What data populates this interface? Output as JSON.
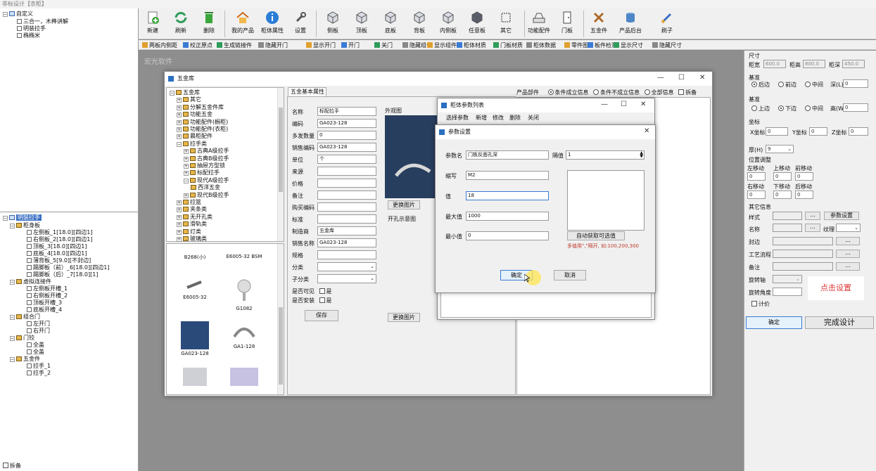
{
  "app": {
    "title": "非标设计【衣柜】",
    "brand": "宏光软件"
  },
  "left_top_tree": {
    "root": "自定义",
    "items": [
      "三合一，木榫讲解",
      "明装拉手",
      "椭椭米"
    ]
  },
  "left_bottom_tree": {
    "root": "明装拉手",
    "groups": [
      {
        "label": "柜身板",
        "items": [
          "左侧板_1[18.0][四边1]",
          "右侧板_2[18.0][四边1]",
          "顶板_3[18.0][四边1]",
          "底板_4[18.0][四边1]",
          "薄背板_5[9.0][不封边]",
          "踢脚板（前）_6[18.0][四边1]",
          "踢脚板（后）_7[18.0][1]"
        ]
      },
      {
        "label": "虚拟连接件",
        "items": [
          "左侧板开槽_1",
          "右侧板开槽_2",
          "顶板开槽_3",
          "底板开槽_4"
        ]
      },
      {
        "label": "组合门",
        "items": [
          "左开门",
          "右开门"
        ]
      },
      {
        "label": "门铰",
        "items": [
          "全盖",
          "全盖"
        ]
      },
      {
        "label": "五金件",
        "items": [
          "拉手_1",
          "拉手_2"
        ]
      }
    ],
    "footer_checkbox": "拆备"
  },
  "toolbar": {
    "buttons": [
      "新建",
      "刷新",
      "删除",
      "我的产品",
      "柜体属性",
      "设置",
      "侧板",
      "顶板",
      "底板",
      "背板",
      "内侧板",
      "任意板",
      "其它",
      "功能配件",
      "门板",
      "五金件",
      "产品后台",
      "刷子"
    ]
  },
  "toolbar2": {
    "items": [
      "两板内侧距",
      "校正原点",
      "生成链接件",
      "隐藏开门",
      "显示开门",
      "开门",
      "关门",
      "隐藏组件",
      "显示组件",
      "柜体材质",
      "门板材质",
      "柜体数据",
      "零件图",
      "板件检测",
      "显示尺寸",
      "隐藏尺寸"
    ]
  },
  "hardware_window": {
    "title": "五金库",
    "tree": [
      "五金库",
      "其它",
      "分解五金件库",
      "功能五金",
      "功能配件(橱柜)",
      "功能配件(衣柜)",
      "晨柜配件",
      "拉手类",
      "古典A级拉手",
      "古典B级拉手",
      "抽屉方型锁",
      "标配拉手",
      "现代A级拉手",
      "西洋五金",
      "现代B级拉手",
      "拉篮",
      "夹条类",
      "无开孔类",
      "滑轨类",
      "灯类",
      "玻璃类"
    ],
    "thumbs": [
      "B268(小)",
      "E6005-32 BSM",
      "E6005-32",
      "G1082",
      "GA023-128",
      "GA1-128",
      "",
      ""
    ],
    "props_tab": "五金基本属性",
    "props": [
      {
        "label": "名称",
        "value": "标配拉手"
      },
      {
        "label": "编码",
        "value": "GA023-128"
      },
      {
        "label": "多发数量",
        "value": "0"
      },
      {
        "label": "销售编码",
        "value": "GA023-128"
      },
      {
        "label": "单位",
        "value": "个"
      },
      {
        "label": "来源",
        "value": ""
      },
      {
        "label": "价格",
        "value": ""
      },
      {
        "label": "备注",
        "value": ""
      },
      {
        "label": "购买编码",
        "value": ""
      },
      {
        "label": "标准",
        "value": ""
      },
      {
        "label": "制造商",
        "value": "五金库"
      },
      {
        "label": "销售名称",
        "value": "GA023-128"
      },
      {
        "label": "规格",
        "value": ""
      },
      {
        "label": "分类",
        "value": ""
      },
      {
        "label": "子分类",
        "value": ""
      }
    ],
    "visible_label": "是否可见",
    "install_label": "是否安装",
    "yes": "是",
    "save": "保存",
    "image_label": "外观图",
    "replace_image": "更换图片",
    "hole_label": "开孔示意图",
    "replace_image2": "更换图片",
    "filter_label": "产品部件",
    "filter_opts": [
      "条件成立信息",
      "条件不成立信息",
      "全部信息"
    ],
    "filter_chk": "拆备"
  },
  "cabinet_params_window": {
    "title": "柜体参数列表",
    "menu": [
      "选择参数",
      "新增",
      "修改",
      "删除",
      "关闭"
    ]
  },
  "param_dialog": {
    "title": "参数设置",
    "name_label": "参数名",
    "name_value": "门板反面孔深",
    "sep_label": "隔值",
    "sep_value": "1",
    "abbr_label": "缩写",
    "abbr_value": "M2",
    "value_label": "值",
    "value_value": "18",
    "max_label": "最大值",
    "max_value": "1000",
    "min_label": "最小值",
    "min_value": "0",
    "auto_btn": "自动获取可选值",
    "hint": "多值用\",\"隔开, 如:100,200,300",
    "ok": "确定",
    "cancel": "取消"
  },
  "right_panel": {
    "size_title": "尺寸",
    "w_label": "柜宽",
    "w_value": "600.0",
    "d_label": "柜高",
    "d_value": "800.0",
    "h_label": "柜深",
    "h_value": "450.0",
    "base1_title": "基准",
    "base1_opts": [
      "后边",
      "前边",
      "中间"
    ],
    "depth_label": "深(L)",
    "depth_value": "0",
    "base2_title": "基准",
    "base2_opts": [
      "上边",
      "下边",
      "中间"
    ],
    "height_label": "高(W)",
    "height_value": "0",
    "coord_title": "坐标",
    "x_label": "X坐标",
    "x_value": "0",
    "y_label": "Y坐标",
    "y_value": "0",
    "z_label": "Z坐标",
    "z_value": "0",
    "thick_label": "厚(H)",
    "thick_value": "9",
    "pos_title": "位置调整",
    "moves": [
      "左移动",
      "上移动",
      "前移动",
      "右移动",
      "下移动",
      "后移动"
    ],
    "move_values": [
      "0",
      "0",
      "0",
      "0",
      "0",
      "0"
    ],
    "other_title": "其它信息",
    "style_label": "样式",
    "param_btn": "参数设置",
    "name_label": "名称",
    "grain_label": "纹理",
    "edge_label": "封边",
    "process_label": "工艺流程",
    "note_label": "备注",
    "axis_label": "旋转轴",
    "angle_label": "旋转角度",
    "price_chk": "计价",
    "click_set": "点击设置",
    "ok": "确定",
    "finish": "完成设计"
  }
}
